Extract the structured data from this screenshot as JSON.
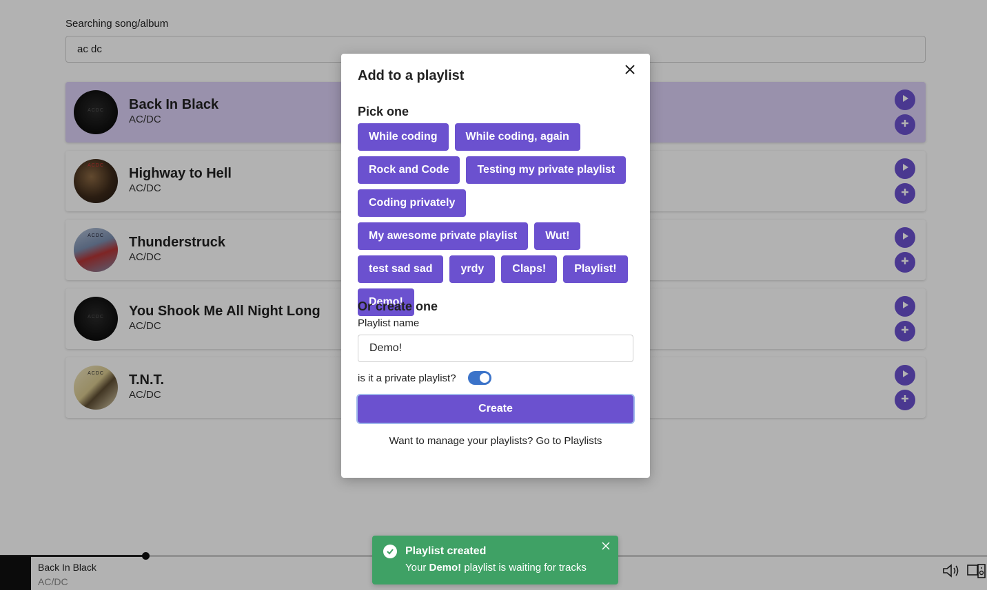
{
  "search": {
    "label": "Searching song/album",
    "value": "ac dc"
  },
  "tracks": [
    {
      "title": "Back In Black",
      "artist": "AC/DC",
      "active": true,
      "cover_text": "ACDC"
    },
    {
      "title": "Highway to Hell",
      "artist": "AC/DC",
      "active": false,
      "cover_text": "ACDC"
    },
    {
      "title": "Thunderstruck",
      "artist": "AC/DC",
      "active": false,
      "cover_text": "ACDC"
    },
    {
      "title": "You Shook Me All Night Long",
      "artist": "AC/DC",
      "active": false,
      "cover_text": "ACDC"
    },
    {
      "title": "T.N.T.",
      "artist": "AC/DC",
      "active": false,
      "cover_text": "ACDC"
    }
  ],
  "player": {
    "title": "Back In Black",
    "artist": "AC/DC",
    "progress": 0.147
  },
  "modal": {
    "title": "Add to a playlist",
    "pick_title": "Pick one",
    "playlists": [
      "While coding",
      "While coding, again",
      "Rock and Code",
      "Testing my private playlist",
      "Coding privately",
      "My awesome private playlist",
      "Wut!",
      "test sad sad",
      "yrdy",
      "Claps!",
      "Playlist!",
      "Demo!"
    ],
    "create_title": "Or create one",
    "name_label": "Playlist name",
    "name_value": "Demo!",
    "private_label": "is it a private playlist?",
    "private_on": true,
    "create_button": "Create",
    "manage_text": "Want to manage your playlists? Go to Playlists"
  },
  "toast": {
    "title": "Playlist created",
    "body_prefix": "Your",
    "body_name": "Demo!",
    "body_suffix": "playlist is waiting for tracks"
  },
  "colors": {
    "accent": "#6b51cf",
    "active_row": "#dcd0f7",
    "toast_success": "#3fa165",
    "toggle_on": "#3b73c9"
  }
}
